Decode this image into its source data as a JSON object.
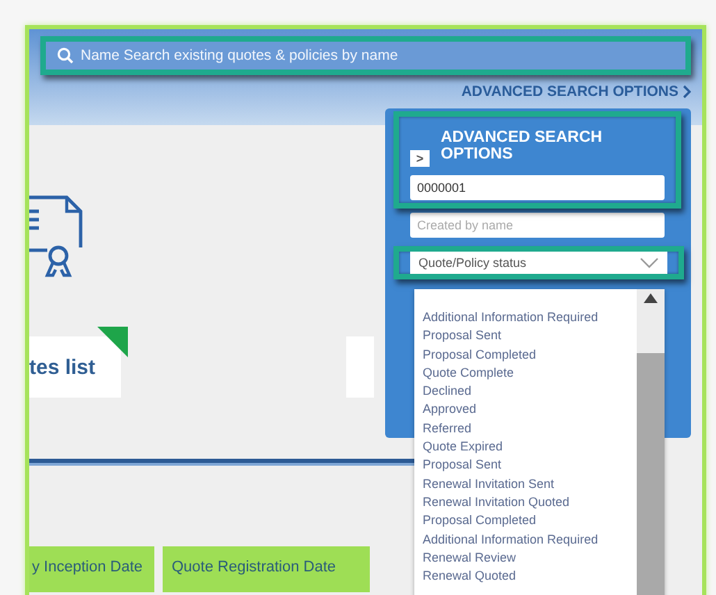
{
  "search": {
    "placeholder": "Name Search existing quotes & policies by name"
  },
  "advanced_link": "ADVANCED SEARCH OPTIONS",
  "advanced_panel": {
    "title": "ADVANCED SEARCH OPTIONS",
    "toggle": ">",
    "fields": [
      {
        "kind": "input",
        "value": "0000001"
      },
      {
        "kind": "input",
        "placeholder": "Created by name"
      },
      {
        "kind": "select",
        "value": "Quote/Policy status",
        "expanded": true
      }
    ],
    "status_options": [
      "Additional Information Required",
      "Proposal Sent",
      "Proposal Completed",
      "Quote Complete",
      "Declined",
      "Approved",
      "Referred",
      "Quote Expired",
      "Proposal Sent",
      "Renewal Invitation Sent",
      "Renewal Invitation Quoted",
      "Proposal Completed",
      "Additional Information Required",
      "Renewal Review",
      "Renewal Quoted"
    ]
  },
  "cards": [
    {
      "label": "tes list",
      "flagged": true
    }
  ],
  "tabs": [
    {
      "label": "y Inception Date"
    },
    {
      "label": "Quote Registration Date"
    }
  ]
}
